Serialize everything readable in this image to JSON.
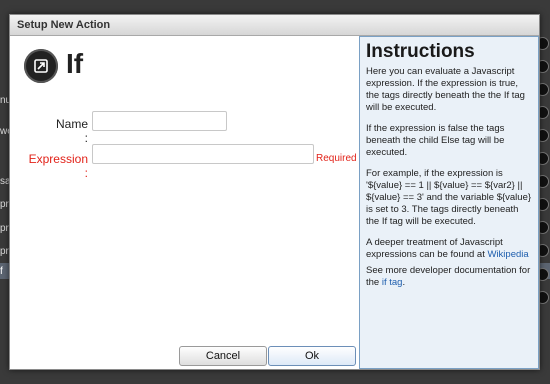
{
  "background": {
    "row_fragments": [
      "nu",
      "we",
      "sa",
      "pre",
      "pre",
      "pre",
      "f"
    ]
  },
  "dialog": {
    "title": "Setup New Action",
    "tag_name": "If",
    "icon": "tag-edit-icon",
    "fields": {
      "name_label": "Name :",
      "name_value": "",
      "expression_label": "Expression :",
      "expression_value": "",
      "required_text": "Required"
    },
    "buttons": {
      "cancel": "Cancel",
      "ok": "Ok"
    }
  },
  "instructions": {
    "heading": "Instructions",
    "p1": "Here you can evaluate a Javascript expression. If the expression is true, the tags directly beneath the the If tag will be executed.",
    "p2": "If the expression is false the tags beneath the child Else tag will be executed.",
    "p3": "For example, if the expression is '${value} == 1 || ${value} == ${var2} || ${value} == 3' and the variable ${value} is set to 3. The tags directly beneath the If tag will be executed.",
    "p4_text": "A deeper treatment of Javascript expressions can be found at",
    "p4_link": "Wikipedia",
    "p5_text": "See more developer documentation for the",
    "p5_link": "if tag",
    "p5_end": "."
  },
  "colors": {
    "required": "#e2231a",
    "instructions_bg": "#eaf1f8",
    "link": "#1f5fae"
  }
}
